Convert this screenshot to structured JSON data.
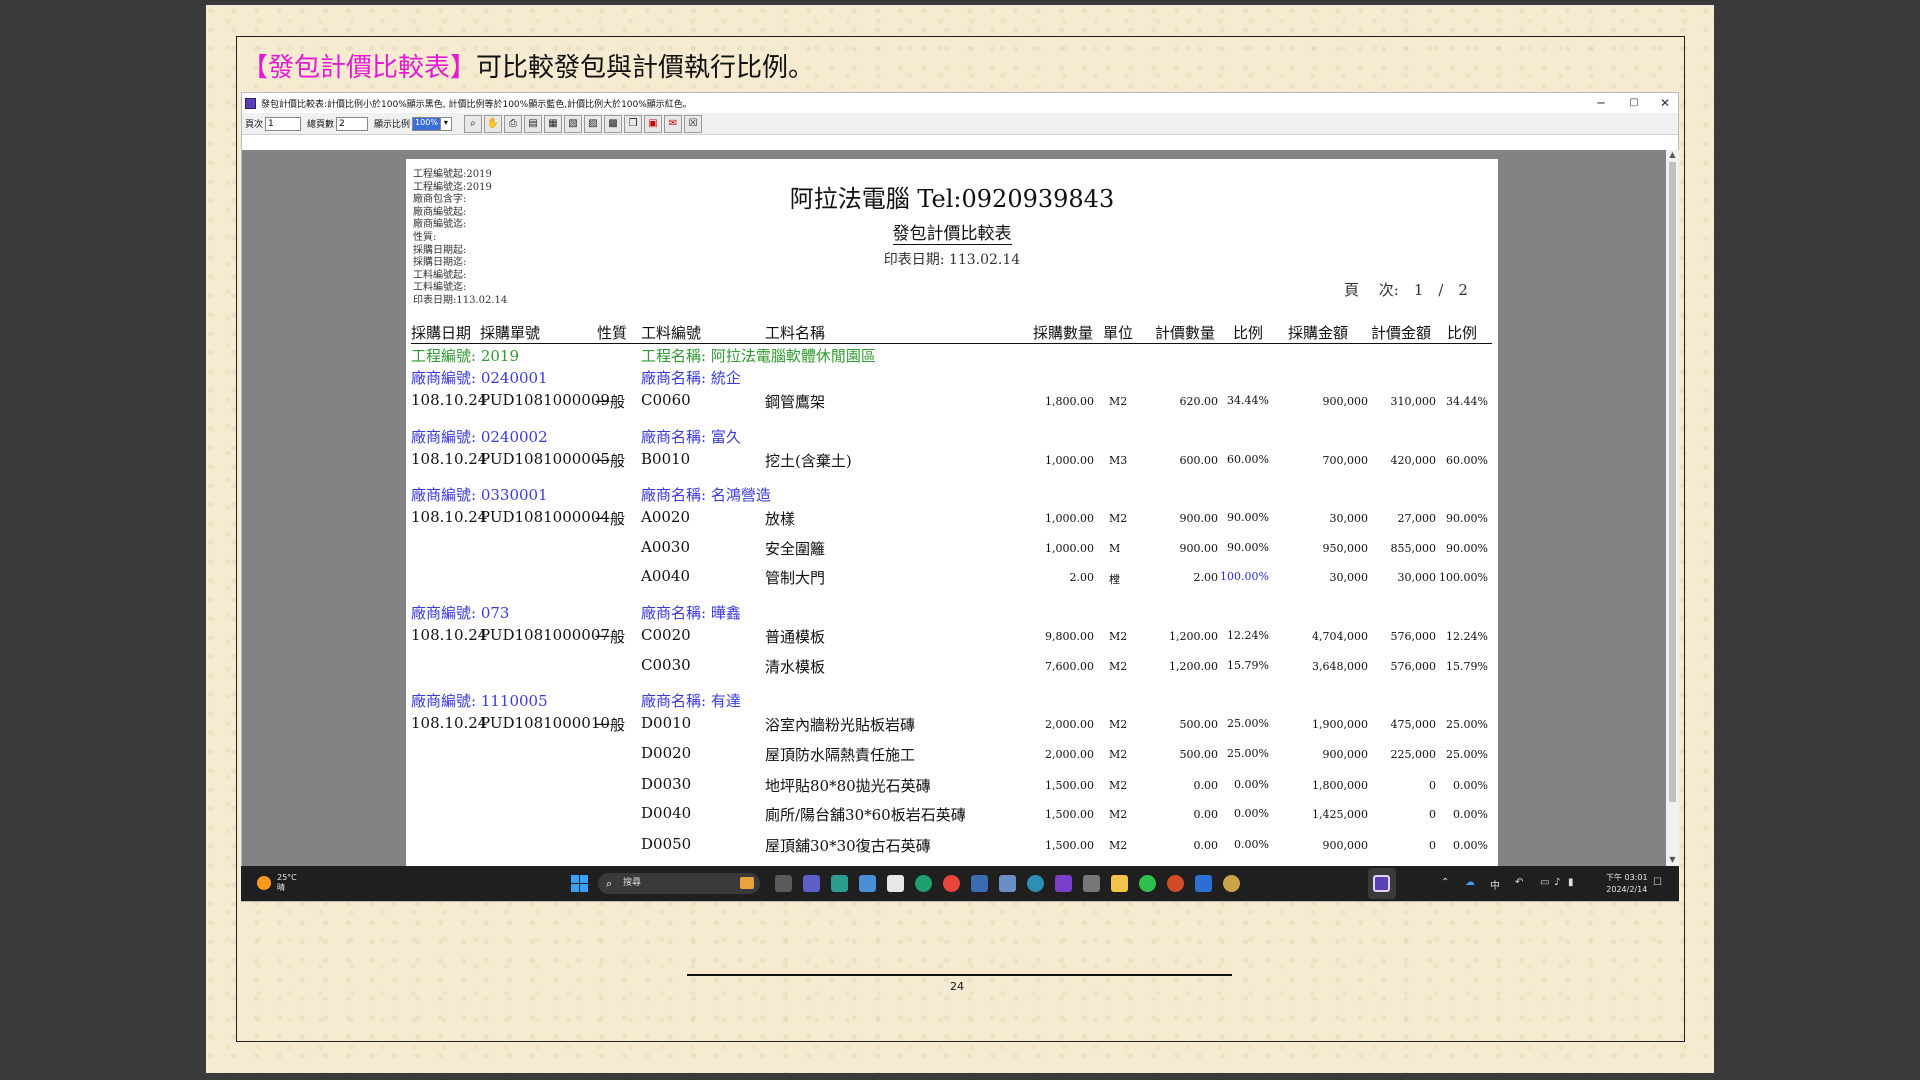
{
  "slide": {
    "heading_highlight": "【發包計價比較表】",
    "heading_rest": "可比較發包與計價執行比例。",
    "page_number": "24"
  },
  "window": {
    "title": "發包計價比較表:計價比例小於100%顯示黑色, 計價比例等於100%顯示藍色,計價比例大於100%顯示紅色。",
    "minimize": "─",
    "maximize": "▢",
    "close": "✕"
  },
  "toolbar": {
    "page_label": "頁次",
    "page_value": "1",
    "total_label": "總頁數",
    "total_value": "2",
    "zoom_label": "顯示比例",
    "zoom_value": "100%"
  },
  "report": {
    "params": [
      "工程編號起:2019",
      "工程編號迄:2019",
      "廠商包含字:",
      "廠商編號起:",
      "廠商編號迄:",
      "性質:",
      "採購日期起:",
      "採購日期迄:",
      "工料編號起:",
      "工料編號迄:",
      "印表日期:113.02.14"
    ],
    "company": "阿拉法電腦 Tel:0920939843",
    "name": "發包計價比較表",
    "print_date": "印表日期: 113.02.14",
    "page": "頁　 次:　1　/　2",
    "headers": {
      "date": "採購日期",
      "po": "採購單號",
      "type": "性質",
      "code": "工料編號",
      "item": "工料名稱",
      "qty": "採購數量",
      "unit": "單位",
      "vqty": "計價數量",
      "ratio1": "比例",
      "amt": "採購金額",
      "vamt": "計價金額",
      "ratio2": "比例"
    },
    "project_no": "工程編號: 2019",
    "project_name": "工程名稱: 阿拉法電腦軟體休閒園區",
    "vendors": [
      {
        "no": "廠商編號: 0240001",
        "name": "廠商名稱: 統企",
        "date": "108.10.24",
        "po": "PUD1081000009",
        "type": "一般",
        "rows": [
          {
            "code": "C0060",
            "item": "鋼管鷹架",
            "qty": "1,800.00",
            "unit": "M2",
            "vqty": "620.00",
            "r1": "34.44%",
            "amt": "900,000",
            "vamt": "310,000",
            "r2": "34.44%"
          }
        ]
      },
      {
        "no": "廠商編號: 0240002",
        "name": "廠商名稱: 富久",
        "date": "108.10.24",
        "po": "PUD1081000005",
        "type": "一般",
        "rows": [
          {
            "code": "B0010",
            "item": "挖土(含棄土)",
            "qty": "1,000.00",
            "unit": "M3",
            "vqty": "600.00",
            "r1": "60.00%",
            "amt": "700,000",
            "vamt": "420,000",
            "r2": "60.00%"
          }
        ]
      },
      {
        "no": "廠商編號: 0330001",
        "name": "廠商名稱: 名鴻營造",
        "date": "108.10.24",
        "po": "PUD1081000004",
        "type": "一般",
        "rows": [
          {
            "code": "A0020",
            "item": "放樣",
            "qty": "1,000.00",
            "unit": "M2",
            "vqty": "900.00",
            "r1": "90.00%",
            "amt": "30,000",
            "vamt": "27,000",
            "r2": "90.00%"
          },
          {
            "code": "A0030",
            "item": "安全圍籬",
            "qty": "1,000.00",
            "unit": "M",
            "vqty": "900.00",
            "r1": "90.00%",
            "amt": "950,000",
            "vamt": "855,000",
            "r2": "90.00%"
          },
          {
            "code": "A0040",
            "item": "管制大門",
            "qty": "2.00",
            "unit": "樘",
            "vqty": "2.00",
            "r1": "100.00%",
            "amt": "30,000",
            "vamt": "30,000",
            "r2": "100.00%"
          }
        ]
      },
      {
        "no": "廠商編號: 073",
        "name": "廠商名稱: 曄鑫",
        "date": "108.10.24",
        "po": "PUD1081000007",
        "type": "一般",
        "rows": [
          {
            "code": "C0020",
            "item": "普通模板",
            "qty": "9,800.00",
            "unit": "M2",
            "vqty": "1,200.00",
            "r1": "12.24%",
            "amt": "4,704,000",
            "vamt": "576,000",
            "r2": "12.24%"
          },
          {
            "code": "C0030",
            "item": "清水模板",
            "qty": "7,600.00",
            "unit": "M2",
            "vqty": "1,200.00",
            "r1": "15.79%",
            "amt": "3,648,000",
            "vamt": "576,000",
            "r2": "15.79%"
          }
        ]
      },
      {
        "no": "廠商編號: 1110005",
        "name": "廠商名稱: 有達",
        "date": "108.10.24",
        "po": "PUD1081000010",
        "type": "一般",
        "rows": [
          {
            "code": "D0010",
            "item": "浴室內牆粉光貼板岩磚",
            "qty": "2,000.00",
            "unit": "M2",
            "vqty": "500.00",
            "r1": "25.00%",
            "amt": "1,900,000",
            "vamt": "475,000",
            "r2": "25.00%"
          },
          {
            "code": "D0020",
            "item": "屋頂防水隔熱責任施工",
            "qty": "2,000.00",
            "unit": "M2",
            "vqty": "500.00",
            "r1": "25.00%",
            "amt": "900,000",
            "vamt": "225,000",
            "r2": "25.00%"
          },
          {
            "code": "D0030",
            "item": "地坪貼80*80拋光石英磚",
            "qty": "1,500.00",
            "unit": "M2",
            "vqty": "0.00",
            "r1": "0.00%",
            "amt": "1,800,000",
            "vamt": "0",
            "r2": "0.00%"
          },
          {
            "code": "D0040",
            "item": "廁所/陽台舖30*60板岩石英磚",
            "qty": "1,500.00",
            "unit": "M2",
            "vqty": "0.00",
            "r1": "0.00%",
            "amt": "1,425,000",
            "vamt": "0",
            "r2": "0.00%"
          },
          {
            "code": "D0050",
            "item": "屋頂舖30*30復古石英磚",
            "qty": "1,500.00",
            "unit": "M2",
            "vqty": "0.00",
            "r1": "0.00%",
            "amt": "900,000",
            "vamt": "0",
            "r2": "0.00%"
          }
        ]
      }
    ]
  },
  "taskbar": {
    "temp": "25°C",
    "weather": "晴",
    "search_placeholder": "搜尋",
    "ime": "中",
    "time": "下午 03:01",
    "date": "2024/2/14",
    "accent": "#3aa0ff"
  }
}
